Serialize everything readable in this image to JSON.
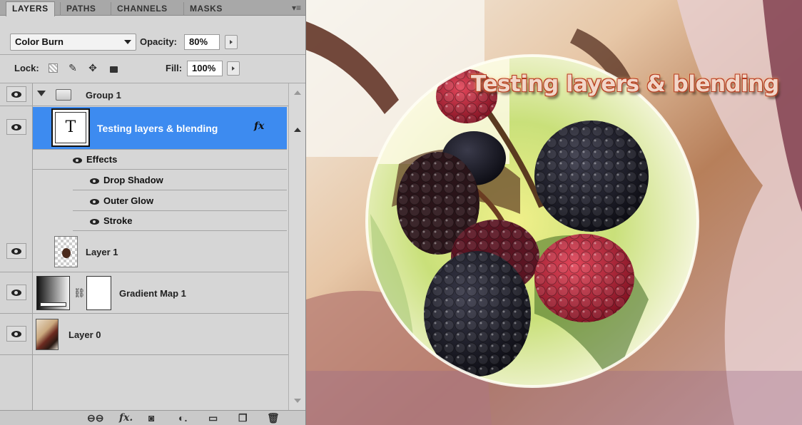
{
  "tabs": [
    "LAYERS",
    "PATHS",
    "CHANNELS",
    "MASKS"
  ],
  "panel_menu_icon": "panel-menu-icon",
  "blend_mode": "Color Burn",
  "opacity_label": "Opacity:",
  "opacity_value": "80%",
  "lock_label": "Lock:",
  "fill_label": "Fill:",
  "fill_value": "100%",
  "layers": {
    "group": "Group 1",
    "text_layer": "Testing layers & blending",
    "fx_label": "fx",
    "effects_label": "Effects",
    "effects": [
      "Drop Shadow",
      "Outer Glow",
      "Stroke"
    ],
    "layer1": "Layer 1",
    "gradient_map": "Gradient Map 1",
    "layer0": "Layer 0"
  },
  "canvas": {
    "title_text": "Testing layers & blending"
  },
  "colors": {
    "selection": "#3d8bf0",
    "panel_bg": "#d6d6d6"
  }
}
